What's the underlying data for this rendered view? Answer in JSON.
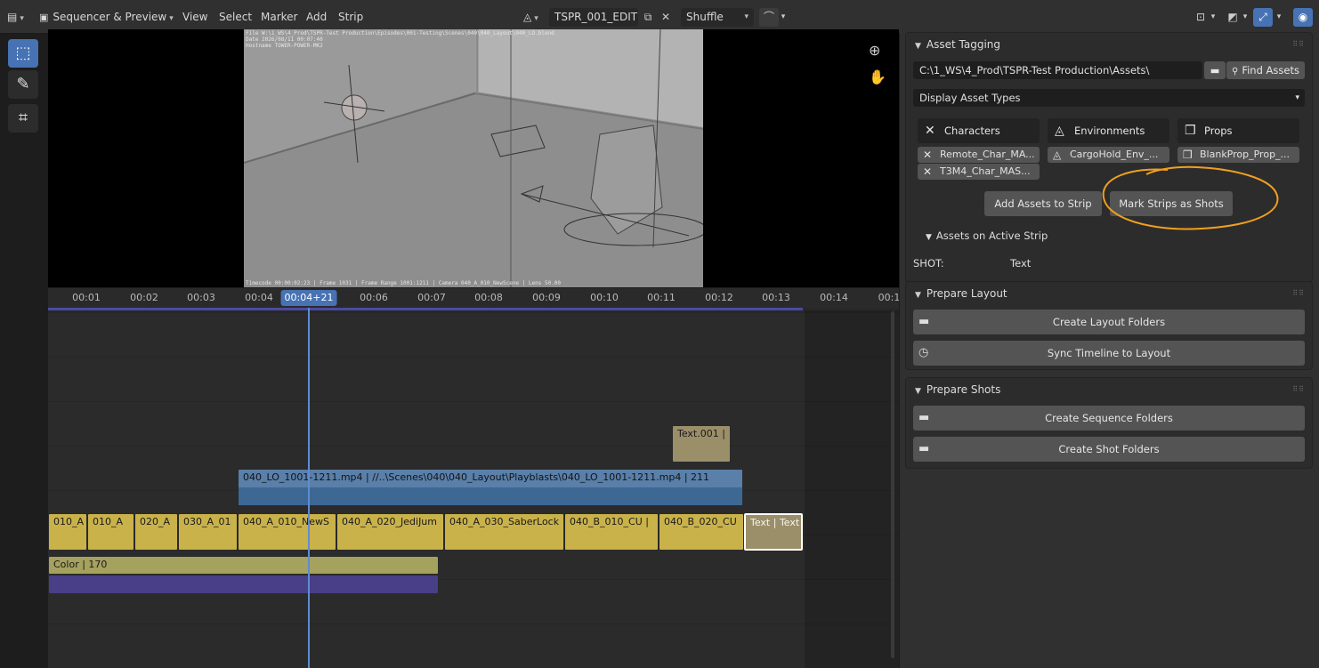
{
  "header": {
    "editor_type": "Sequencer & Preview",
    "menus": [
      "View",
      "Select",
      "Marker",
      "Add",
      "Strip"
    ],
    "scene_name": "TSPR_001_EDIT",
    "overlap_mode": "Shuffle"
  },
  "preview": {
    "metadata": {
      "file": "File W:\\1_WS\\4_Prod\\TSPR-Test Production\\Episodes\\001-Testing\\Scenes\\040\\040_Layout\\040_LO.blend",
      "date": "Date 2026/08/11 00:07:40",
      "hostname": "Hostname TOWER-POWER-MK2",
      "footer": "Timecode 00:00:02:23 | Frame 1031 | Frame Range 1001:1211 | Camera 040_A_010_NewScene | Lens 50.00"
    }
  },
  "timeline": {
    "current_time": "00:04+21",
    "ticks": [
      "00:01",
      "00:02",
      "00:03",
      "00:04",
      "00:06",
      "00:07",
      "00:08",
      "00:09",
      "00:10",
      "00:11",
      "00:12",
      "00:13",
      "00:14",
      "00:1"
    ],
    "strips": {
      "text_001": "Text.001 |",
      "movie": "040_LO_1001-1211.mp4 | //..\\Scenes\\040\\040_Layout\\Playblasts\\040_LO_1001-1211.mp4 | 211",
      "shots": [
        "010_A",
        "010_A",
        "020_A",
        "030_A_01",
        "040_A_010_NewS",
        "040_A_020_JediJum",
        "040_A_030_SaberLock",
        "040_B_010_CU |",
        "040_B_020_CU"
      ],
      "text_selected": "Text | Text",
      "color": "Color | 170"
    }
  },
  "panel": {
    "asset_tagging": {
      "title": "Asset Tagging",
      "path": "C:\\1_WS\\4_Prod\\TSPR-Test Production\\Assets\\",
      "find_label": "Find Assets",
      "display_types": "Display Asset Types",
      "columns": [
        {
          "header": "Characters",
          "items": [
            "Remote_Char_MA...",
            "T3M4_Char_MAS..."
          ]
        },
        {
          "header": "Environments",
          "items": [
            "CargoHold_Env_..."
          ]
        },
        {
          "header": "Props",
          "items": [
            "BlankProp_Prop_..."
          ]
        }
      ],
      "add_assets": "Add Assets to Strip",
      "mark_strips": "Mark Strips as Shots",
      "assets_on_strip": "Assets on Active Strip",
      "shot_label": "SHOT:",
      "shot_value": "Text"
    },
    "prepare_layout": {
      "title": "Prepare Layout",
      "buttons": [
        "Create Layout Folders",
        "Sync Timeline to Layout"
      ]
    },
    "prepare_shots": {
      "title": "Prepare Shots",
      "buttons": [
        "Create Sequence Folders",
        "Create Shot Folders"
      ]
    }
  },
  "colors": {
    "accent": "#4772b3",
    "annotation": "#f0a020",
    "shot_strip": "#c9b24a",
    "movie_strip": "#5a7fa8"
  }
}
